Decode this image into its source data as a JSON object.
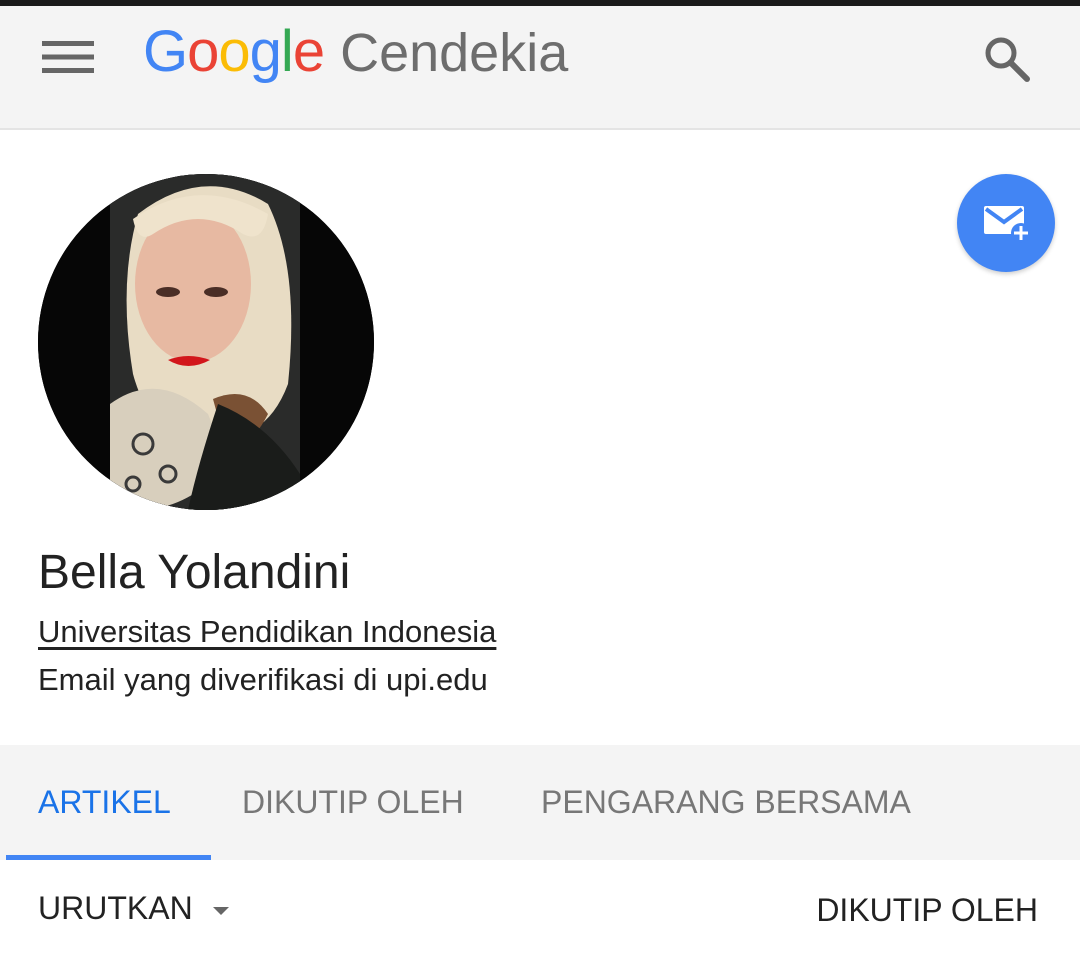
{
  "header": {
    "logo_text": "Google",
    "product_name": "Cendekia",
    "menu_icon": "hamburger-menu-icon",
    "search_icon": "search-icon",
    "logo_colors": [
      "#4285f4",
      "#ea4335",
      "#fbbc05",
      "#4285f4",
      "#34a853",
      "#ea4335"
    ]
  },
  "profile": {
    "name": "Bella Yolandini",
    "affiliation": "Universitas Pendidikan Indonesia",
    "email_note": "Email yang diverifikasi di upi.edu",
    "photo_icon": "profile-photo",
    "follow_icon": "email-alert-add-icon"
  },
  "tabs": [
    {
      "label": "ARTIKEL",
      "active": true
    },
    {
      "label": "DIKUTIP OLEH",
      "active": false
    },
    {
      "label": "PENGARANG BERSAMA",
      "active": false
    }
  ],
  "list": {
    "sort_label": "URUTKAN",
    "sort_icon": "caret-down-icon",
    "cited_by_header": "DIKUTIP OLEH"
  },
  "colors": {
    "accent": "#1a73e8",
    "fab": "#4285f4",
    "header_bg": "#f4f4f4",
    "tab_inactive": "#777777"
  }
}
